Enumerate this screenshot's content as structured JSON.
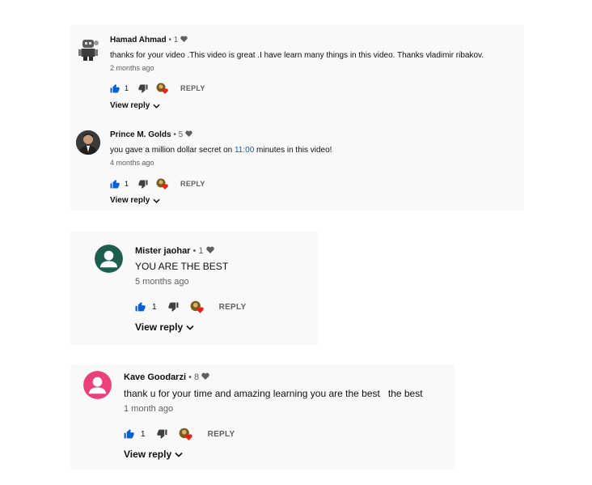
{
  "card1": {
    "comments": [
      {
        "author": "Hamad Ahmad",
        "sep": "•",
        "heart_count": "1",
        "text": "thanks for your video .This video is great .I have learn many things in this video. Thanks vladimir ribakov.",
        "time": "2 months ago",
        "likes": "1",
        "reply": "REPLY",
        "view_reply": "View reply"
      },
      {
        "author": "Prince M. Golds",
        "sep": "•",
        "heart_count": "5",
        "text_before": "you gave a million dollar secret on ",
        "timestamp_link": "11:00",
        "text_after": " minutes in this video!",
        "time": "4 months ago",
        "likes": "1",
        "reply": "REPLY",
        "view_reply": "View reply"
      }
    ]
  },
  "card2": {
    "author": "Mister jaohar",
    "sep": "•",
    "heart_count": "1",
    "text": "YOU ARE THE BEST",
    "time": "5 months ago",
    "likes": "1",
    "reply": "REPLY",
    "view_reply": "View reply",
    "avatar_color": "#1e5e4e"
  },
  "card3": {
    "author": "Kave Goodarzi",
    "sep": "•",
    "heart_count": "8",
    "text": "thank u for your time and amazing learning you are the best   the best",
    "time": "1 month ago",
    "likes": "1",
    "reply": "REPLY",
    "view_reply": "View reply",
    "avatar_color": "#ec407a"
  },
  "colors": {
    "like_blue": "#065fd4",
    "heart_red": "#e62117",
    "card_bg": "#f9f9f9"
  }
}
